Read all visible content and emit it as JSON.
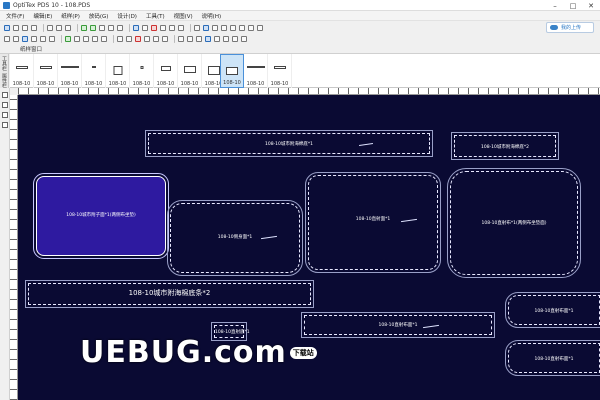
{
  "window": {
    "title": "OptiTex PDS 10 - 108.PDS",
    "min": "–",
    "max": "□",
    "close": "✕"
  },
  "menu": [
    "文件(F)",
    "编辑(E)",
    "纸样(P)",
    "放码(G)",
    "设计(D)",
    "工具(T)",
    "视图(V)",
    "说明(H)"
  ],
  "cloud": {
    "label": "我的上传"
  },
  "panel": {
    "tab": "纸样窗口"
  },
  "vtabs": [
    "工具栏",
    "属性栏"
  ],
  "thumbnails": [
    {
      "label": "108-10"
    },
    {
      "label": "108-10"
    },
    {
      "label": "108-10"
    },
    {
      "label": "108-10"
    },
    {
      "label": "108-10"
    },
    {
      "label": "108-10"
    },
    {
      "label": "108-10"
    },
    {
      "label": "108-10"
    },
    {
      "label": "108-10"
    },
    {
      "label": "108-10"
    },
    {
      "label": "108-10"
    },
    {
      "label": "108-10"
    }
  ],
  "pieces": [
    {
      "id": "p1",
      "label": "108-10城市附海棉底*1"
    },
    {
      "id": "p2",
      "label": "108-10城市附海棉底*2"
    },
    {
      "id": "p3",
      "label": "108-10城市附子面*1(两侧布坐垫)"
    },
    {
      "id": "p4",
      "label": "108-10侧身面*1"
    },
    {
      "id": "p5",
      "label": "108-10直射面*1"
    },
    {
      "id": "p6",
      "label": "108-10直射布*1(两侧布坐垫面)"
    },
    {
      "id": "p7",
      "label": "108-10直射布面*1"
    },
    {
      "id": "p8",
      "label": "108-10城市附海棉底条*2"
    },
    {
      "id": "p9",
      "label": "108-10直射底*1"
    },
    {
      "id": "p10",
      "label": "108-10直射面料*1"
    },
    {
      "id": "p11",
      "label": "108-10直射布面*1"
    },
    {
      "id": "p12",
      "label": "108-10直射布面*1"
    }
  ],
  "watermark": {
    "text": "UEBUG.com",
    "badge": "下载站"
  },
  "colors": {
    "canvas": "#0a0a33",
    "selected_piece": "#2e1aa0",
    "accent": "#2a78c5"
  }
}
